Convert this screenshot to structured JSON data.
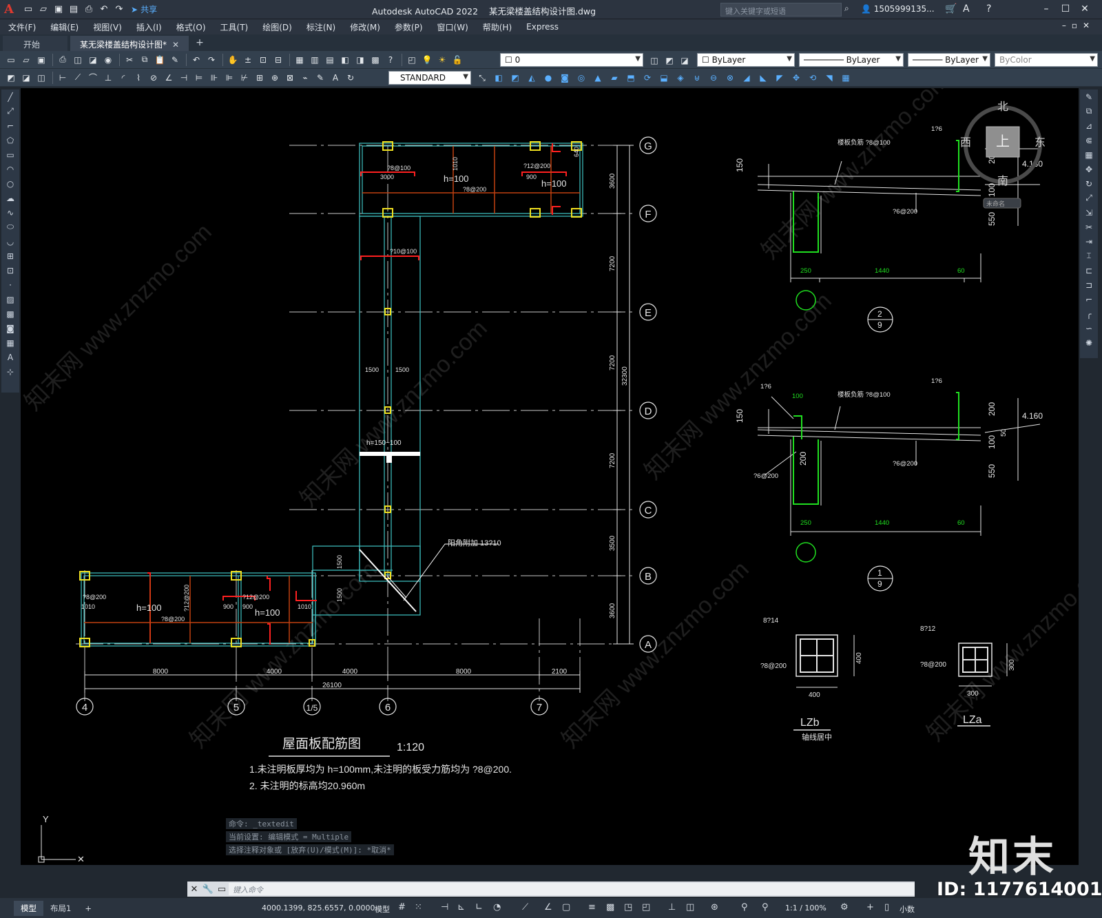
{
  "title_bar": {
    "app_title": "Autodesk AutoCAD 2022",
    "file_name": "某无梁楼盖结构设计图.dwg",
    "share_label": "共享",
    "search_placeholder": "键入关键字或短语",
    "user": "1505999135..."
  },
  "menu": [
    "文件(F)",
    "编辑(E)",
    "视图(V)",
    "插入(I)",
    "格式(O)",
    "工具(T)",
    "绘图(D)",
    "标注(N)",
    "修改(M)",
    "参数(P)",
    "窗口(W)",
    "帮助(H)",
    "Express"
  ],
  "tabs": [
    {
      "label": "开始",
      "active": false
    },
    {
      "label": "某无梁楼盖结构设计图*",
      "active": true
    }
  ],
  "toolbar": {
    "layer_value": "0",
    "color_value": "ByLayer",
    "linetype_value": "ByLayer",
    "lineweight_value": "ByLayer",
    "plotstyle_value": "ByColor",
    "dimstyle_value": "STANDARD"
  },
  "viewcube": {
    "north": "北",
    "south": "南",
    "east": "东",
    "west": "西",
    "top": "上",
    "wcs_label": "未命名"
  },
  "drawing": {
    "plan_title": "屋面板配筋图",
    "plan_scale": "1:120",
    "note1": "1.未注明板厚均为 h=100mm,未注明的板受力筋均为 ?8@200.",
    "note2": "2. 未注明的标高均20.960m",
    "axis_rows": [
      "G",
      "F",
      "E",
      "D",
      "C",
      "B",
      "A"
    ],
    "axis_cols": [
      "4",
      "5",
      "1/5",
      "6",
      "7"
    ],
    "row_dims": [
      "3600",
      "7200",
      "7200",
      "7200",
      "3500",
      "3600"
    ],
    "row_total": "32300",
    "col_dims": [
      "8000",
      "4000",
      "4000",
      "8000",
      "2100"
    ],
    "col_total": "26100",
    "slab_labels": [
      "h=100",
      "h=100",
      "h=100",
      "h=100",
      "h=150~100"
    ],
    "rebar_labels": [
      "?8@100",
      "3000",
      "?8@200",
      "1010",
      "?12@200",
      "900",
      "640",
      "?10@100",
      "1500",
      "阳角附加 13?10",
      "?8@200",
      "1010",
      "?12@200",
      "?8@200"
    ],
    "section1": {
      "label_top": "楼板负筋 ?8@100",
      "corner": "1?6",
      "elev": "4.130",
      "bottom_bar": "?6@200",
      "dims": [
        "250",
        "1440",
        "60"
      ],
      "heights": [
        "150",
        "200",
        "100",
        "550"
      ],
      "tag_top": "2",
      "tag_bot": "9"
    },
    "section2": {
      "label_top": "楼板负筋 ?8@100",
      "corner_left": "1?6",
      "corner_right": "1?6",
      "elev": "4.160",
      "bottom_bar": "?6@200",
      "left_bar": "?6@200",
      "dims": [
        "250",
        "1440",
        "60"
      ],
      "heights": [
        "150",
        "200",
        "100",
        "550",
        "50"
      ],
      "w": "100",
      "h": "200",
      "tag_top": "1",
      "tag_bot": "9"
    },
    "column_b": {
      "top_bar": "8?14",
      "stirrup": "?8@200",
      "width": "400",
      "height": "400",
      "name": "LZb",
      "note": "轴线居中"
    },
    "column_a": {
      "top_bar": "8?12",
      "stirrup": "?8@200",
      "width": "300",
      "height": "300",
      "name": "LZa"
    }
  },
  "command": {
    "history": [
      "命令: _textedit",
      "当前设置: 编辑模式 = Multiple",
      "选择注释对象或 [放弃(U)/模式(M)]: *取消*"
    ],
    "placeholder": "键入命令"
  },
  "status": {
    "layouts": [
      "模型",
      "布局1"
    ],
    "coordinates": "4000.1399, 825.6557, 0.0000",
    "mode": "模型",
    "scale": "1:1 / 100%",
    "units": "小数"
  },
  "watermark": {
    "brand": "知末",
    "id": "ID: 1177614001",
    "site": "知末网 www.znzmo.com"
  },
  "colors": {
    "cyan": "#3fc6c6",
    "yellow": "#f0e020",
    "red": "#ff2020",
    "green": "#20e020",
    "white": "#e6e6e6",
    "orange": "#c04010"
  }
}
